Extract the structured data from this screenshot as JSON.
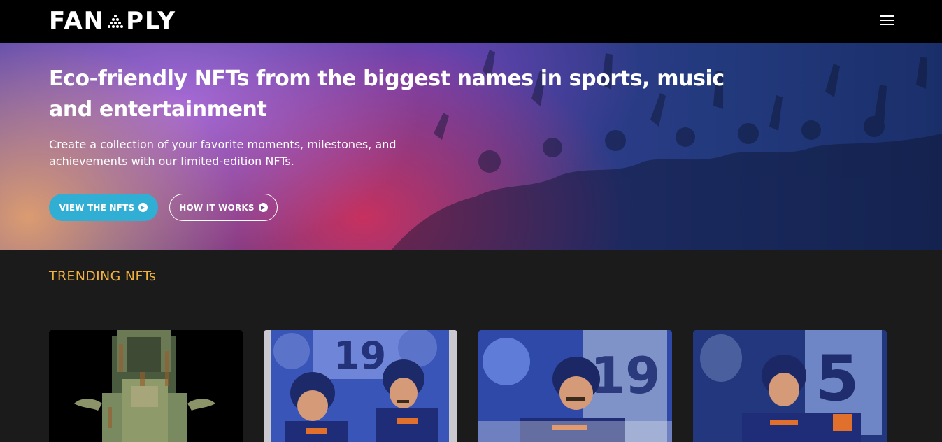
{
  "header": {
    "logo_text_left": "FAN",
    "logo_text_right": "PLY",
    "logo_icon": "triangle-dots-icon",
    "menu_icon": "hamburger-menu-icon"
  },
  "hero": {
    "title": "Eco-friendly NFTs from the biggest names in sports, music and entertainment",
    "subtitle": "Create a collection of your favorite moments, milestones, and achievements with our limited-edition NFTs.",
    "primary_button": "VIEW THE NFTS",
    "secondary_button": "HOW IT WORKS",
    "button_icon": "arrow-circle-right-icon"
  },
  "trending": {
    "title": "TRENDING NFTs",
    "cards": [
      {
        "image": "bronze-throne-statue"
      },
      {
        "image": "hockey-players-illustration-19"
      },
      {
        "image": "hockey-players-illustration-19-mustache"
      },
      {
        "image": "hockey-players-illustration-5"
      }
    ]
  },
  "colors": {
    "accent": "#30aed4",
    "section_title": "#f0b23c",
    "background": "#1b1b1b"
  }
}
